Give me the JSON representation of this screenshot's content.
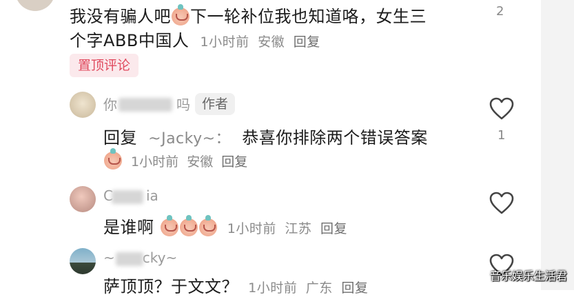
{
  "pinned_comment": {
    "line1_a": "我没有骗人吧",
    "line1_b": "下一轮补位我也知道咯，女生三",
    "line2": "个字ABB中国人",
    "time": "1小时前",
    "location": "安徽",
    "reply_label": "回复",
    "pin_badge": "置顶评论",
    "like_count": "2"
  },
  "reply1": {
    "name_visible_start": "你",
    "name_visible_end": "吗",
    "author_badge": "作者",
    "text_reply": "回复",
    "text_target": "~Jacky~：",
    "text_body": "恭喜你排除两个错误答案",
    "time": "1小时前",
    "location": "安徽",
    "reply_label": "回复",
    "like_count": "1"
  },
  "reply2": {
    "name_start": "C",
    "name_end": "ia",
    "text": "是谁啊",
    "time": "1小时前",
    "location": "江苏",
    "reply_label": "回复"
  },
  "reply3": {
    "name_start": "~",
    "name_end": "cky~",
    "text": "萨顶顶？于文文？",
    "time": "1小时前",
    "location": "广东",
    "reply_label": "回复"
  },
  "watermark": "音乐娱乐生活君",
  "icons": {
    "heart": "heart-outline-icon",
    "emoji": "sticker-emoji-icon"
  }
}
